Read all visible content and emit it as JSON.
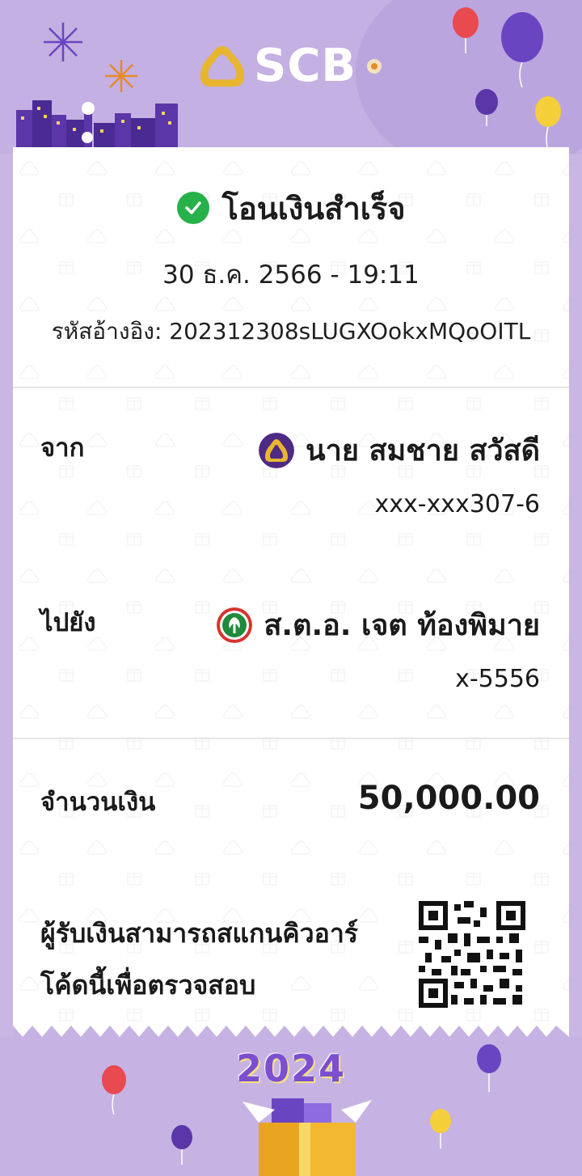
{
  "header": {
    "brand": "SCB",
    "logo_icon": "scb-emblem-icon",
    "colors": {
      "background": "#c4b0e2",
      "logo_gold": "#e8b530"
    }
  },
  "receipt": {
    "status": "โอนเงินสำเร็จ",
    "status_icon": "check-circle-icon",
    "datetime": "30 ธ.ค. 2566 - 19:11",
    "reference": "รหัสอ้างอิง: 202312308sLUGXOokxMQoOITL",
    "from": {
      "label": "จาก",
      "name": "นาย สมชาย สวัสดี",
      "account": "xxx-xxx307-6",
      "bank_icon": "scb-bank-icon"
    },
    "to": {
      "label": "ไปยัง",
      "name": "ส.ต.อ. เจต ท้องพิมาย",
      "account": "x-5556",
      "bank_icon": "kbank-bank-icon"
    },
    "amount": {
      "label": "จำนวนเงิน",
      "value": "50,000.00"
    },
    "scan": {
      "text": "ผู้รับเงินสามารถสแกนคิวอาร์โค้ดนี้เพื่อตรวจสอบ",
      "qr_icon": "qr-code-icon"
    }
  },
  "footer": {
    "year": "2024"
  },
  "colors": {
    "success": "#27b14a",
    "scb_purple": "#4e2a84",
    "kbank_green": "#1f8a3b"
  }
}
